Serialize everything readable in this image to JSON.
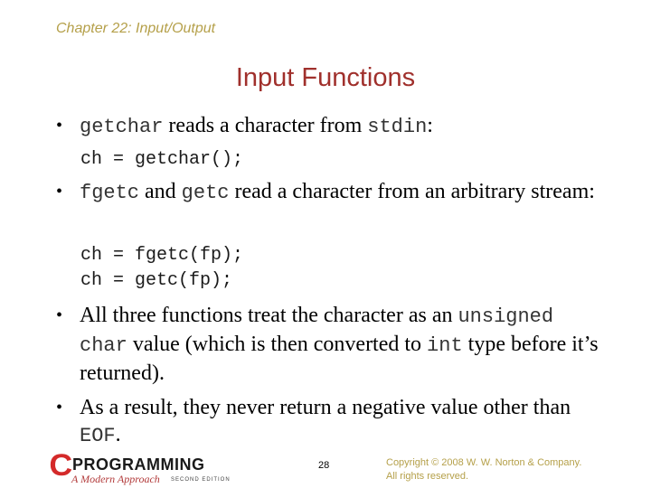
{
  "header": {
    "chapter": "Chapter 22: Input/Output",
    "title": "Input Functions"
  },
  "bullets": [
    {
      "segments": [
        {
          "text": "getchar",
          "code": true
        },
        {
          "text": " reads a character from ",
          "code": false
        },
        {
          "text": "stdin",
          "code": true
        },
        {
          "text": ":",
          "code": false
        }
      ],
      "code_lines": [
        "ch = getchar();"
      ]
    },
    {
      "segments": [
        {
          "text": "fgetc",
          "code": true
        },
        {
          "text": " and ",
          "code": false
        },
        {
          "text": "getc",
          "code": true
        },
        {
          "text": " read a character from an arbitrary stream:",
          "code": false
        }
      ],
      "code_lines": [
        "ch = fgetc(fp);",
        "ch = getc(fp);"
      ]
    },
    {
      "segments": [
        {
          "text": "All three functions treat the character as an ",
          "code": false
        },
        {
          "text": "unsigned char",
          "code": true
        },
        {
          "text": " value (which is then converted to ",
          "code": false
        },
        {
          "text": "int",
          "code": true
        },
        {
          "text": " type before it’s returned).",
          "code": false
        }
      ],
      "code_lines": []
    },
    {
      "segments": [
        {
          "text": "As a result, they never return a negative value other than ",
          "code": false
        },
        {
          "text": "EOF",
          "code": true
        },
        {
          "text": ".",
          "code": false
        }
      ],
      "code_lines": []
    }
  ],
  "bullet_glyph": "•",
  "footer": {
    "logo": {
      "c_letter": "C",
      "word": "PROGRAMMING",
      "subtitle": "A Modern Approach",
      "edition": "SECOND EDITION"
    },
    "page_number": "28",
    "copyright_line1": "Copyright © 2008 W. W. Norton & Company.",
    "copyright_line2": "All rights reserved."
  },
  "colors": {
    "chapter": "#b5a04a",
    "title": "#a0302c",
    "logo_red": "#d42a2a",
    "copyright": "#b5a04a"
  }
}
